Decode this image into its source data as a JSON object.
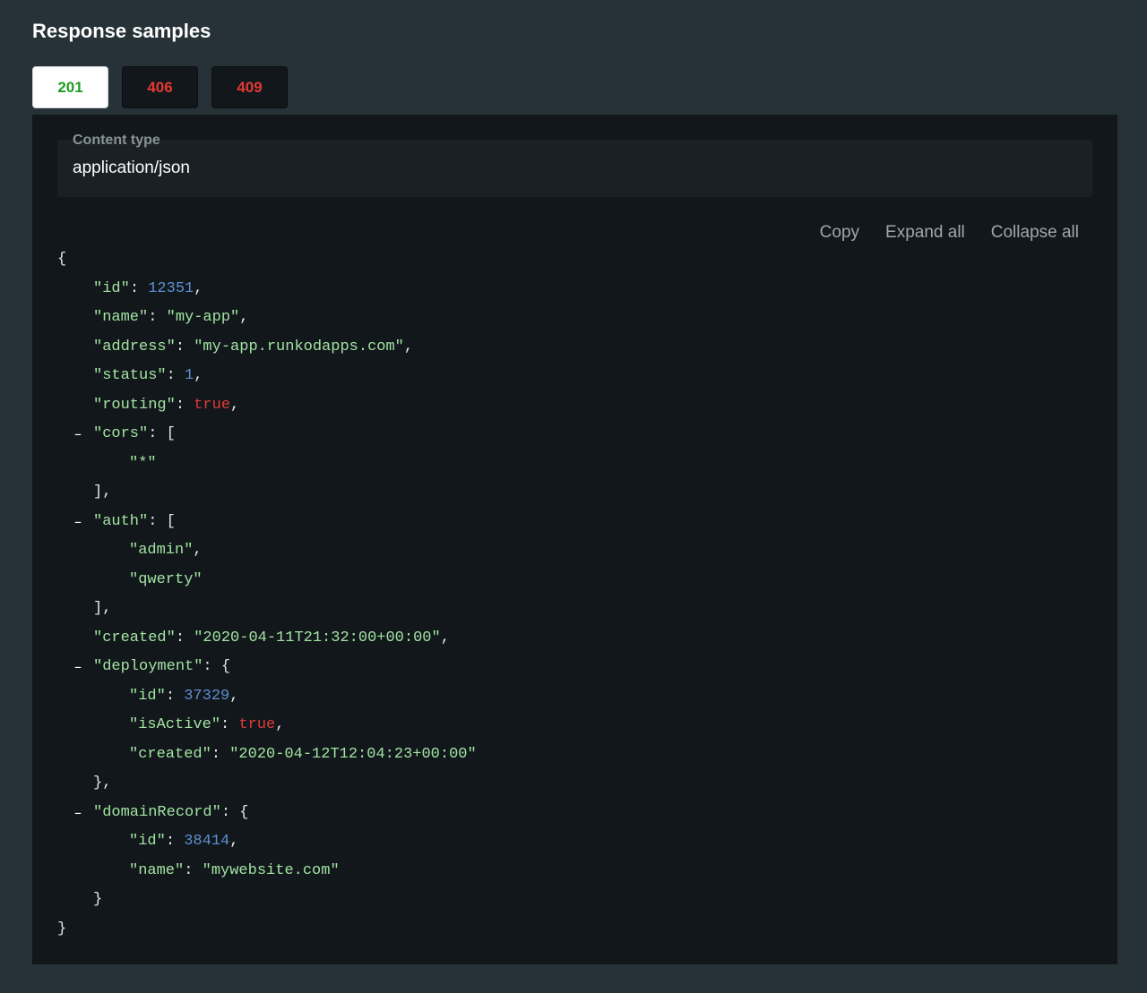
{
  "title": "Response samples",
  "tabs": [
    {
      "label": "201",
      "color": "#1f9d1f",
      "active": true
    },
    {
      "label": "406",
      "color": "#e53935",
      "active": false
    },
    {
      "label": "409",
      "color": "#e53935",
      "active": false
    }
  ],
  "content_type": {
    "label": "Content type",
    "value": "application/json"
  },
  "controls": {
    "copy": "Copy",
    "expand_all": "Expand all",
    "collapse_all": "Collapse all"
  },
  "json": {
    "toggle_symbol": "–",
    "lines": [
      {
        "text": [
          {
            "t": "{",
            "c": "p"
          }
        ]
      },
      {
        "text": [
          {
            "t": "\"id\"",
            "c": "k"
          },
          {
            "t": ": ",
            "c": "p"
          },
          {
            "t": "12351",
            "c": "n"
          },
          {
            "t": ",",
            "c": "p"
          }
        ]
      },
      {
        "text": [
          {
            "t": "\"name\"",
            "c": "k"
          },
          {
            "t": ": ",
            "c": "p"
          },
          {
            "t": "\"my-app\"",
            "c": "s"
          },
          {
            "t": ",",
            "c": "p"
          }
        ]
      },
      {
        "text": [
          {
            "t": "\"address\"",
            "c": "k"
          },
          {
            "t": ": ",
            "c": "p"
          },
          {
            "t": "\"my-app.runkodapps.com\"",
            "c": "s"
          },
          {
            "t": ",",
            "c": "p"
          }
        ]
      },
      {
        "text": [
          {
            "t": "\"status\"",
            "c": "k"
          },
          {
            "t": ": ",
            "c": "p"
          },
          {
            "t": "1",
            "c": "n"
          },
          {
            "t": ",",
            "c": "p"
          }
        ]
      },
      {
        "text": [
          {
            "t": "\"routing\"",
            "c": "k"
          },
          {
            "t": ": ",
            "c": "p"
          },
          {
            "t": "true",
            "c": "b"
          },
          {
            "t": ",",
            "c": "p"
          }
        ]
      },
      {
        "toggle": true,
        "text": [
          {
            "t": "\"cors\"",
            "c": "k"
          },
          {
            "t": ": [",
            "c": "p"
          }
        ]
      },
      {
        "text": [
          {
            "t": "\"*\"",
            "c": "s"
          }
        ]
      },
      {
        "text": [
          {
            "t": "],",
            "c": "p"
          }
        ]
      },
      {
        "toggle": true,
        "text": [
          {
            "t": "\"auth\"",
            "c": "k"
          },
          {
            "t": ": [",
            "c": "p"
          }
        ]
      },
      {
        "text": [
          {
            "t": "\"admin\"",
            "c": "s"
          },
          {
            "t": ",",
            "c": "p"
          }
        ]
      },
      {
        "text": [
          {
            "t": "\"qwerty\"",
            "c": "s"
          }
        ]
      },
      {
        "text": [
          {
            "t": "],",
            "c": "p"
          }
        ]
      },
      {
        "text": [
          {
            "t": "\"created\"",
            "c": "k"
          },
          {
            "t": ": ",
            "c": "p"
          },
          {
            "t": "\"2020-04-11T21:32:00+00:00\"",
            "c": "s"
          },
          {
            "t": ",",
            "c": "p"
          }
        ]
      },
      {
        "toggle": true,
        "text": [
          {
            "t": "\"deployment\"",
            "c": "k"
          },
          {
            "t": ": {",
            "c": "p"
          }
        ]
      },
      {
        "text": [
          {
            "t": "\"id\"",
            "c": "k"
          },
          {
            "t": ": ",
            "c": "p"
          },
          {
            "t": "37329",
            "c": "n"
          },
          {
            "t": ",",
            "c": "p"
          }
        ]
      },
      {
        "text": [
          {
            "t": "\"isActive\"",
            "c": "k"
          },
          {
            "t": ": ",
            "c": "p"
          },
          {
            "t": "true",
            "c": "b"
          },
          {
            "t": ",",
            "c": "p"
          }
        ]
      },
      {
        "text": [
          {
            "t": "\"created\"",
            "c": "k"
          },
          {
            "t": ": ",
            "c": "p"
          },
          {
            "t": "\"2020-04-12T12:04:23+00:00\"",
            "c": "s"
          }
        ]
      },
      {
        "text": [
          {
            "t": "},",
            "c": "p"
          }
        ]
      },
      {
        "toggle": true,
        "text": [
          {
            "t": "\"domainRecord\"",
            "c": "k"
          },
          {
            "t": ": {",
            "c": "p"
          }
        ]
      },
      {
        "text": [
          {
            "t": "\"id\"",
            "c": "k"
          },
          {
            "t": ": ",
            "c": "p"
          },
          {
            "t": "38414",
            "c": "n"
          },
          {
            "t": ",",
            "c": "p"
          }
        ]
      },
      {
        "text": [
          {
            "t": "\"name\"",
            "c": "k"
          },
          {
            "t": ": ",
            "c": "p"
          },
          {
            "t": "\"mywebsite.com\"",
            "c": "s"
          }
        ]
      },
      {
        "text": [
          {
            "t": "}",
            "c": "p"
          }
        ]
      },
      {
        "text": [
          {
            "t": "}",
            "c": "p"
          }
        ]
      }
    ]
  }
}
